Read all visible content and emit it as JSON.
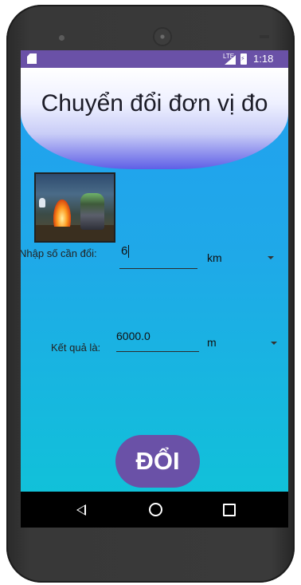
{
  "status_bar": {
    "network": "LTE",
    "time": "1:18"
  },
  "header": {
    "title": "Chuyển đổi đơn vị đo"
  },
  "image": {
    "description_icon": "campfire-knight-image"
  },
  "input_row": {
    "label": "Nhập số cần đổi:",
    "value": "6",
    "unit_selected": "km"
  },
  "result_row": {
    "label": "Kết quả là:",
    "value": "6000.0",
    "unit_selected": "m"
  },
  "convert_button": {
    "label": "ĐỔI"
  },
  "nav_bar": {
    "back_icon": "back-icon",
    "home_icon": "home-icon",
    "recents_icon": "recents-icon"
  },
  "colors": {
    "accent": "#6a51a7",
    "background_top": "#22a0f0",
    "background_bottom": "#11c1d9"
  }
}
